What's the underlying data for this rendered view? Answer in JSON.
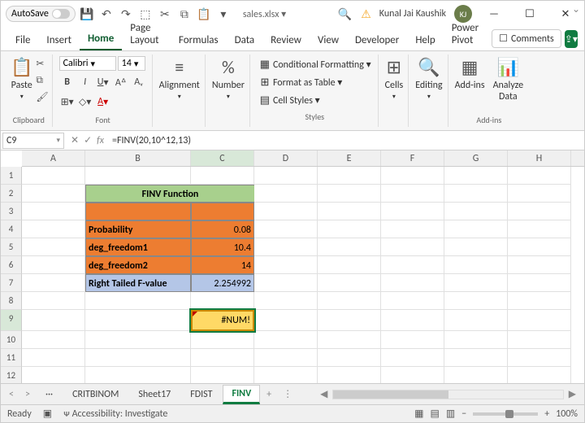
{
  "title": {
    "autosave": "AutoSave",
    "filename": "sales.xlsx ▾",
    "search_ph": "",
    "user": "Kunal Jai Kaushik",
    "initials": "KJ"
  },
  "tabs": {
    "file": "File",
    "insert": "Insert",
    "home": "Home",
    "pagelayout": "Page Layout",
    "formulas": "Formulas",
    "data": "Data",
    "review": "Review",
    "view": "View",
    "developer": "Developer",
    "help": "Help",
    "powerpivot": "Power Pivot",
    "comments": "Comments"
  },
  "ribbon": {
    "paste": "Paste",
    "clipboard": "Clipboard",
    "font_name": "Calibri",
    "font_size": "14",
    "font": "Font",
    "alignment": "Alignment",
    "number": "Number",
    "cond": "Conditional Formatting ▾",
    "fmt_table": "Format as Table ▾",
    "cell_styles": "Cell Styles ▾",
    "styles": "Styles",
    "cells": "Cells",
    "editing": "Editing",
    "addins": "Add-ins",
    "analyze": "Analyze\nData",
    "addins_grp": "Add-ins"
  },
  "formula": {
    "name_box": "C9",
    "fx": "=FINV(20,10^12,13)"
  },
  "cols": [
    "A",
    "B",
    "C",
    "D",
    "E",
    "F",
    "G",
    "H"
  ],
  "sheet": {
    "title": "FINV Function",
    "r4l": "Probability",
    "r4v": "0.08",
    "r5l": "deg_freedom1",
    "r5v": "10.4",
    "r6l": "deg_freedom2",
    "r6v": "14",
    "r7l": "Right Tailed F-value",
    "r7v": "2.254992",
    "err": "#NUM!"
  },
  "chart_data": {
    "type": "table",
    "title": "FINV Function",
    "rows": [
      {
        "label": "Probability",
        "value": 0.08
      },
      {
        "label": "deg_freedom1",
        "value": 10.4
      },
      {
        "label": "deg_freedom2",
        "value": 14
      },
      {
        "label": "Right Tailed F-value",
        "value": 2.254992
      }
    ],
    "error_cell": {
      "address": "C9",
      "formula": "=FINV(20,10^12,13)",
      "result": "#NUM!"
    }
  },
  "sheets": {
    "s1": "CRITBINOM",
    "s2": "Sheet17",
    "s3": "FDIST",
    "s4": "FINV",
    "ellipsis": "···",
    "more": "⋮"
  },
  "status": {
    "ready": "Ready",
    "access": "Accessibility: Investigate",
    "zoom": "100%",
    "plus": "+",
    "minus": "−"
  }
}
